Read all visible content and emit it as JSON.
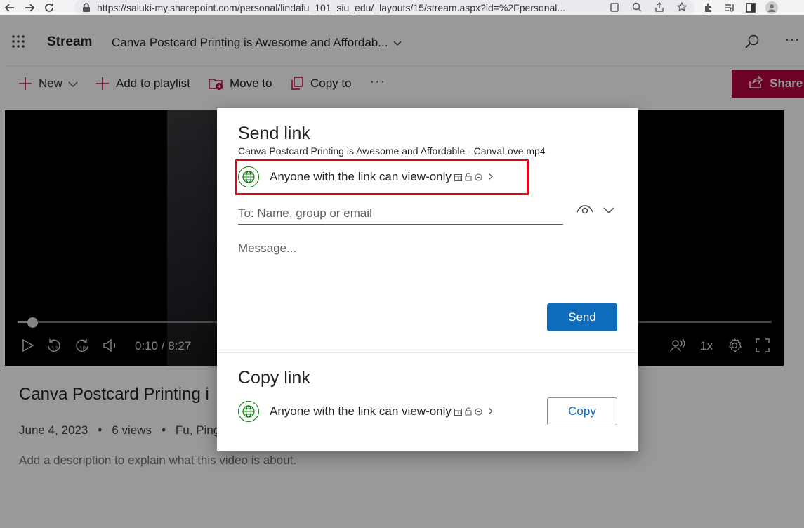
{
  "browser": {
    "url": "https://saluki-my.sharepoint.com/personal/lindafu_101_siu_edu/_layouts/15/stream.aspx?id=%2Fpersonal...",
    "back_icon": "arrow-left-icon",
    "forward_icon": "arrow-right-icon",
    "reload_icon": "reload-icon"
  },
  "header": {
    "app_name": "Stream",
    "doc_title": "Canva Postcard Printing is Awesome and Affordab..."
  },
  "commands": {
    "new_label": "New",
    "add_to_playlist_label": "Add to playlist",
    "move_to_label": "Move to",
    "copy_to_label": "Copy to",
    "more_label": "···",
    "share_label": "Share"
  },
  "player": {
    "time": "0:10 / 8:27",
    "rate": "1x",
    "progress_fraction": 0.02
  },
  "video": {
    "title": "Canva Postcard Printing i",
    "date": "June 4, 2023",
    "views": "6 views",
    "author": "Fu, Pingp",
    "bullet": "•",
    "description": "Add a description to explain what this video is about."
  },
  "dialog": {
    "title": "Send link",
    "file_name": "Canva Postcard Printing is Awesome and Affordable - CanvaLove.mp4",
    "permission": "Anyone with the link can view-only",
    "to_placeholder": "To: Name, group or email",
    "message_placeholder": "Message...",
    "send_label": "Send",
    "copy_title": "Copy link",
    "copy_permission": "Anyone with the link can view-only",
    "copy_label": "Copy"
  },
  "colors": {
    "share_accent": "#b4063f",
    "primary": "#0f6cbd",
    "highlight": "#e3001b",
    "globe": "#107c10"
  }
}
